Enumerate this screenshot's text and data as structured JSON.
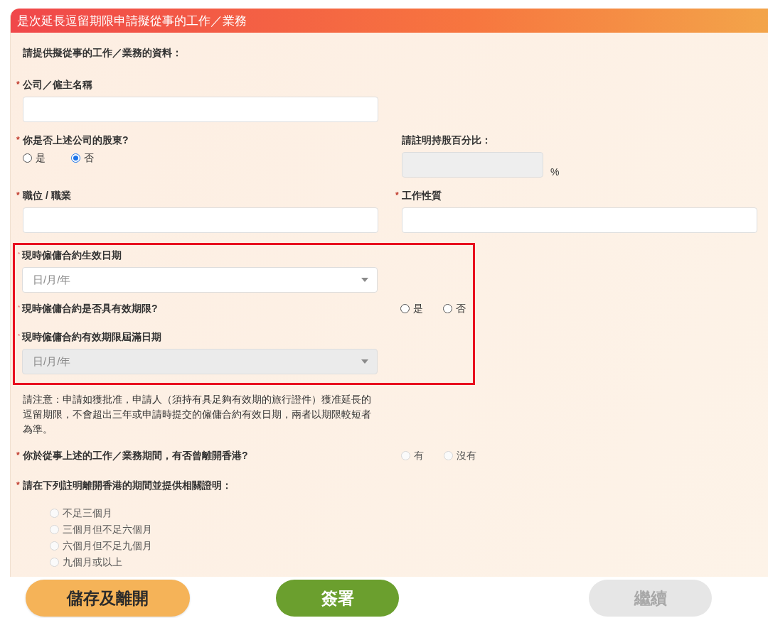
{
  "section": {
    "title": "是次延長逗留期限申請擬從事的工作／業務"
  },
  "intro": "請提供擬從事的工作／業務的資料：",
  "rows": [
    {
      "items": [
        {
          "kind": "text",
          "label": "公司／僱主名稱",
          "mark": "*",
          "disabled": false
        }
      ]
    },
    {
      "items": [
        {
          "kind": "radio",
          "label": "你是否上述公司的股東?",
          "mark": "*",
          "options": [
            {
              "label": "是",
              "selected": false,
              "disabled": false
            },
            {
              "label": "否",
              "selected": true,
              "disabled": false
            }
          ]
        },
        {
          "kind": "text",
          "label": "請註明持股百分比：",
          "disabled": true,
          "suffix": "%"
        }
      ]
    },
    {
      "items": [
        {
          "kind": "text",
          "label": "職位 / 職業",
          "mark": "*",
          "disabled": false
        },
        {
          "kind": "text",
          "label": "工作性質",
          "mark": "*",
          "disabled": false
        }
      ]
    }
  ],
  "highlighted_rows": [
    {
      "items": [
        {
          "kind": "date",
          "label": "現時僱傭合約生效日期",
          "mark": "*",
          "placeholder": "日/月/年",
          "disabled": false
        }
      ]
    },
    {
      "items": [
        {
          "kind": "question",
          "label": "現時僱傭合約是否具有效期限?",
          "mark": "*",
          "options": [
            {
              "label": "是",
              "selected": false,
              "disabled": false
            },
            {
              "label": "否",
              "selected": false,
              "disabled": false
            }
          ]
        }
      ]
    },
    {
      "items": [
        {
          "kind": "date",
          "label": "現時僱傭合約有效期限屆滿日期",
          "mark": "*",
          "placeholder": "日/月/年",
          "disabled": true
        }
      ]
    }
  ],
  "rows_after": [
    {
      "items": [
        {
          "kind": "note",
          "text": "請注意：申請如獲批准，申請人（須持有具足夠有效期的旅行證件）獲准延長的逗留期限，不會超出三年或申請時提交的僱傭合約有效日期，兩者以期限較短者為準。"
        }
      ]
    },
    {
      "items": [
        {
          "kind": "question",
          "label": "你於從事上述的工作／業務期間，有否曾離開香港?",
          "mark": "*",
          "options": [
            {
              "label": "有",
              "selected": false,
              "disabled": true
            },
            {
              "label": "沒有",
              "selected": false,
              "disabled": true
            }
          ]
        }
      ]
    },
    {
      "items": [
        {
          "kind": "list",
          "label": "請在下列註明離開香港的期間並提供相關證明：",
          "mark": "*",
          "options": [
            {
              "label": "不足三個月",
              "selected": false,
              "disabled": true
            },
            {
              "label": "三個月但不足六個月",
              "selected": false,
              "disabled": true
            },
            {
              "label": "六個月但不足九個月",
              "selected": false,
              "disabled": true
            },
            {
              "label": "九個月或以上",
              "selected": false,
              "disabled": true
            }
          ]
        }
      ]
    }
  ],
  "buttons": [
    {
      "label": "儲存及離開",
      "kind": "secondary",
      "disabled": false
    },
    {
      "label": "簽署",
      "kind": "primary",
      "disabled": false
    },
    {
      "label": "繼續",
      "kind": "primary",
      "disabled": true
    }
  ]
}
